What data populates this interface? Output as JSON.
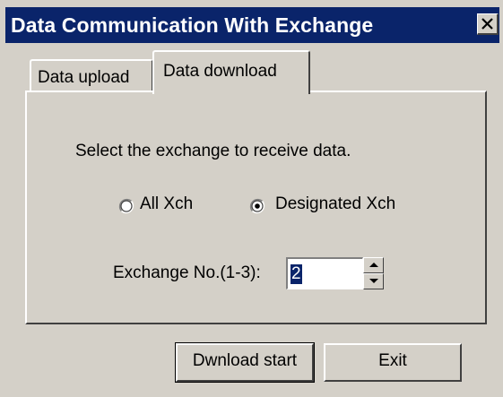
{
  "window": {
    "title": "Data Communication With Exchange",
    "title_bar_color": "#0a246a",
    "face_color": "#d4d0c8"
  },
  "tabs": [
    {
      "label": "Data upload",
      "selected": false
    },
    {
      "label": "Data download",
      "selected": true
    }
  ],
  "panel": {
    "instruction": "Select the exchange to receive data.",
    "radios": [
      {
        "label": "All Xch",
        "checked": false
      },
      {
        "label": "Designated Xch",
        "checked": true
      }
    ],
    "exchange_no": {
      "label": "Exchange No.(1-3):",
      "value": "2"
    }
  },
  "buttons": {
    "download_start": "Dwnload start",
    "exit": "Exit"
  },
  "icons": {
    "close": "close-icon",
    "radio_unchecked": "radio-unchecked-icon",
    "radio_checked": "radio-checked-icon",
    "spin_up": "spin-up-arrow-icon",
    "spin_down": "spin-down-arrow-icon"
  }
}
